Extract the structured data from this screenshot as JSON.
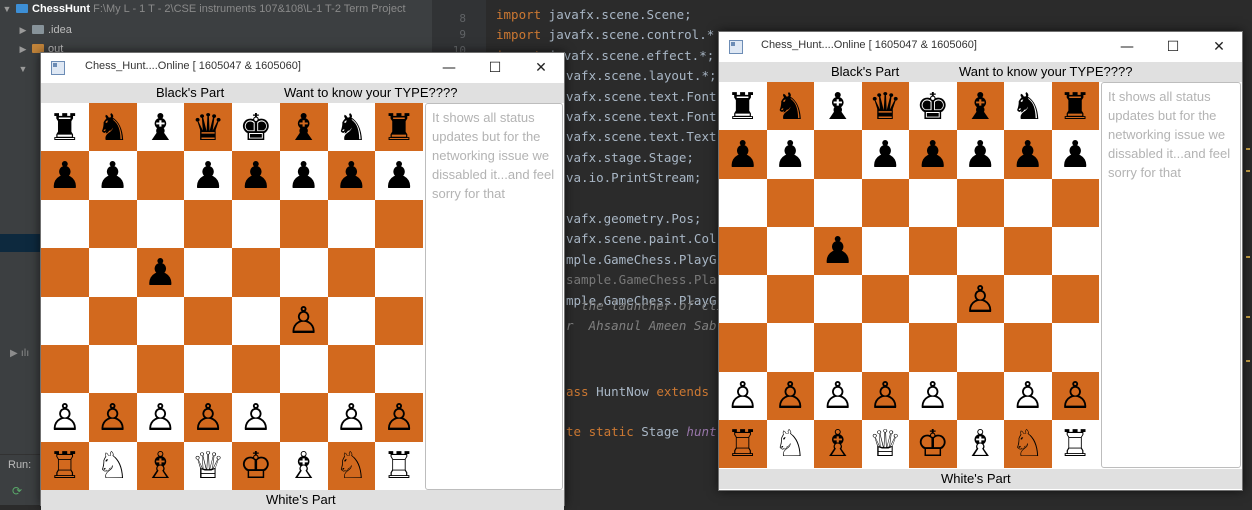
{
  "ide": {
    "tree": {
      "project_name": "ChessHunt",
      "project_path": "F:\\My L - 1 T - 2\\CSE instruments 107&108\\L-1 T-2 Term Project",
      "items": [
        ".idea",
        "out"
      ]
    },
    "run_label": "Run:",
    "line_numbers": [
      "8",
      "9",
      "10"
    ],
    "code_lines": [
      {
        "pre": "",
        "kw": "import",
        "rest": " javafx.scene.Scene;"
      },
      {
        "pre": "",
        "kw": "import",
        "rest": " javafx.scene.control.*"
      },
      {
        "pre": "",
        "kw": "import",
        "rest": " javafx.scene.effect.*;"
      },
      {
        "pre": "",
        "kw": "",
        "rest": "vafx.scene.layout.*;"
      },
      {
        "pre": "",
        "kw": "",
        "rest": "vafx.scene.text.Font"
      },
      {
        "pre": "",
        "kw": "",
        "rest": "vafx.scene.text.Font"
      },
      {
        "pre": "",
        "kw": "",
        "rest": "vafx.scene.text.Text"
      },
      {
        "pre": "",
        "kw": "",
        "rest": "vafx.stage.Stage;"
      },
      {
        "pre": "",
        "kw": "",
        "rest": "va.io.PrintStream;"
      },
      {
        "pre": "",
        "kw": "",
        "rest": ""
      },
      {
        "pre": "",
        "kw": "",
        "rest": "vafx.geometry.Pos;"
      },
      {
        "pre": "",
        "kw": "",
        "rest": "vafx.scene.paint.Col"
      },
      {
        "pre": "",
        "kw": "",
        "rest": "mple.GameChess.PlayG"
      },
      {
        "pre": "",
        "kw": "",
        "rest": "sample.GameChess.Pla"
      },
      {
        "pre": "",
        "kw": "",
        "rest": "mple.GameChess.PlayG"
      }
    ],
    "comment_line_1": "  the launcher of cli",
    "comment_line_2": "r  Ahsanul Ameen Sab",
    "class_line_kw": "ass",
    "class_line_name": " HuntNow ",
    "class_line_ext": "extends",
    "field_line_kw": "te static",
    "field_line_type": " Stage ",
    "field_line_name": "hunt"
  },
  "window_left": {
    "title": "Chess_Hunt....Online [ 1605047 & 1605060]",
    "minimize": "—",
    "maximize": "☐",
    "close": "✕",
    "top_left_label": "Black's Part",
    "top_right_label": "Want to know your TYPE????",
    "status_text": "It shows all status updates but for the networking issue we dissabled it...and feel sorry for that",
    "bottom_label": "White's Part",
    "board": [
      [
        "♜",
        "♞",
        "♝",
        "♛",
        "♚",
        "♝",
        "♞",
        "♜"
      ],
      [
        "♟",
        "♟",
        "",
        "♟",
        "♟",
        "♟",
        "♟",
        "♟"
      ],
      [
        "",
        "",
        "",
        "",
        "",
        "",
        "",
        ""
      ],
      [
        "",
        "",
        "♟",
        "",
        "",
        "",
        "",
        ""
      ],
      [
        "",
        "",
        "",
        "",
        "",
        "♙",
        "",
        ""
      ],
      [
        "",
        "",
        "",
        "",
        "",
        "",
        "",
        ""
      ],
      [
        "♙",
        "♙",
        "♙",
        "♙",
        "♙",
        "",
        "♙",
        "♙"
      ],
      [
        "♖",
        "♘",
        "♗",
        "♕",
        "♔",
        "♗",
        "♘",
        "♖"
      ]
    ]
  },
  "window_right": {
    "title": "Chess_Hunt....Online [ 1605047 & 1605060]",
    "minimize": "—",
    "maximize": "☐",
    "close": "✕",
    "top_left_label": "Black's Part",
    "top_right_label": "Want to know your TYPE????",
    "status_text": "It shows all status updates but for the networking issue we dissabled it...and feel sorry for that",
    "bottom_label": "White's Part",
    "board": [
      [
        "♜",
        "♞",
        "♝",
        "♛",
        "♚",
        "♝",
        "♞",
        "♜"
      ],
      [
        "♟",
        "♟",
        "",
        "♟",
        "♟",
        "♟",
        "♟",
        "♟"
      ],
      [
        "",
        "",
        "",
        "",
        "",
        "",
        "",
        ""
      ],
      [
        "",
        "",
        "♟",
        "",
        "",
        "",
        "",
        ""
      ],
      [
        "",
        "",
        "",
        "",
        "",
        "♙",
        "",
        ""
      ],
      [
        "",
        "",
        "",
        "",
        "",
        "",
        "",
        ""
      ],
      [
        "♙",
        "♙",
        "♙",
        "♙",
        "♙",
        "",
        "♙",
        "♙"
      ],
      [
        "♖",
        "♘",
        "♗",
        "♕",
        "♔",
        "♗",
        "♘",
        "♖"
      ]
    ]
  },
  "colors": {
    "dark_square": "#d2691e",
    "light_square": "#ffffff"
  }
}
